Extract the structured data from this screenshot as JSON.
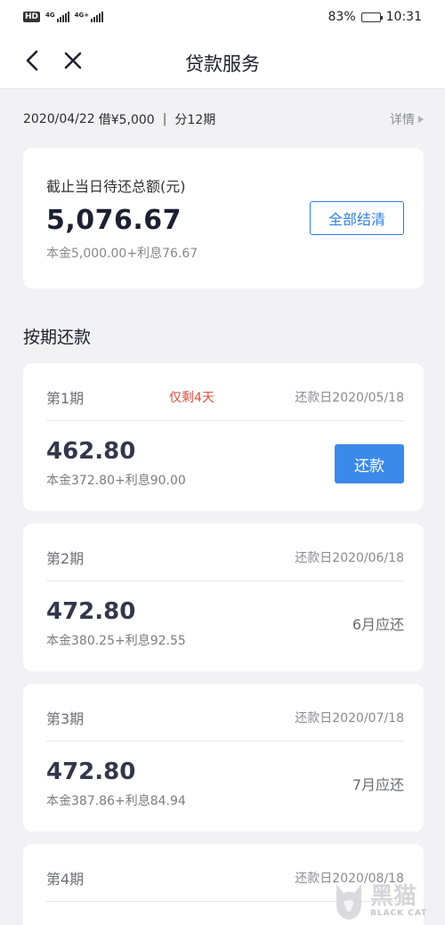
{
  "status_bar": {
    "hd_label": "HD",
    "sim1_label": "4G",
    "sim2_label": "4G+",
    "battery_text": "83%",
    "battery_level": 0.83,
    "time": "10:31"
  },
  "nav": {
    "title": "贷款服务",
    "back_icon": "chevron-left-icon",
    "close_icon": "close-icon"
  },
  "loan_summary": {
    "date": "2020/04/22",
    "borrowed": "借¥5,000",
    "separator": "|",
    "installments": "分12期",
    "details_label": "详情"
  },
  "total_due": {
    "label": "截止当日待还总额(元)",
    "amount": "5,076.67",
    "breakdown": "本金5,000.00+利息76.67",
    "settle_button": "全部结清"
  },
  "installments_section": {
    "title": "按期还款",
    "periods": [
      {
        "name": "第1期",
        "remaining": "仅剩4天",
        "due_date": "还款日2020/05/18",
        "amount": "462.80",
        "breakdown": "本金372.80+利息90.00",
        "pay_button": "还款"
      },
      {
        "name": "第2期",
        "due_date": "还款日2020/06/18",
        "amount": "472.80",
        "breakdown": "本金380.25+利息92.55",
        "status": "6月应还"
      },
      {
        "name": "第3期",
        "due_date": "还款日2020/07/18",
        "amount": "472.80",
        "breakdown": "本金387.86+利息84.94",
        "status": "7月应还"
      },
      {
        "name": "第4期",
        "due_date": "还款日2020/08/18"
      }
    ]
  },
  "watermark": {
    "cn": "黑猫",
    "en": "BLACK CAT"
  },
  "colors": {
    "accent": "#3b89e8",
    "outline_button": "#2f7fdf",
    "warning": "#d9503f",
    "background": "#f2f2f4"
  }
}
